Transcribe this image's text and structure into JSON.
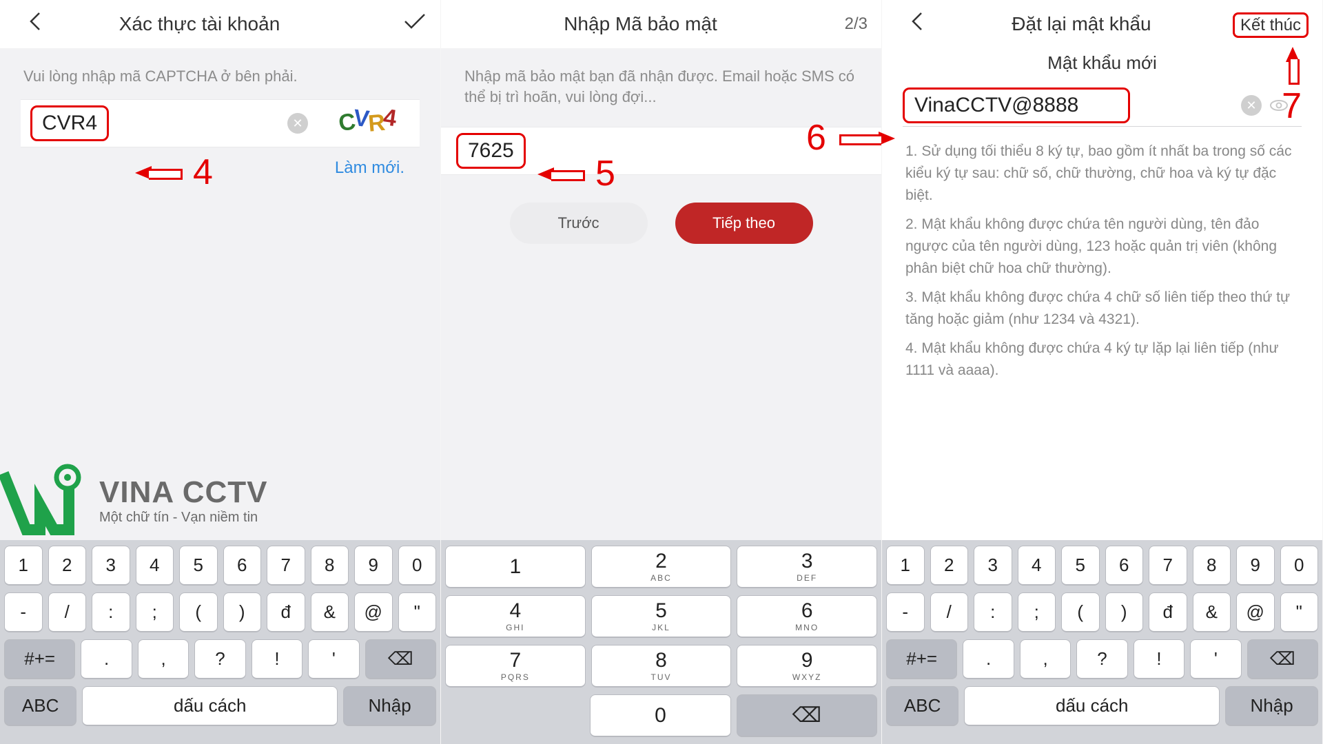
{
  "p1": {
    "title": "Xác thực tài khoản",
    "instruction": "Vui lòng nhập mã CAPTCHA ở bên phải.",
    "captcha_value": "CVR4",
    "captcha_chars": [
      "C",
      "V",
      "R",
      "4"
    ],
    "refresh": "Làm mới.",
    "anno": "4"
  },
  "p2": {
    "title": "Nhập Mã bảo mật",
    "step": "2/3",
    "instruction": "Nhập mã bảo mật bạn đã nhận được. Email hoặc SMS có thể bị trì hoãn, vui lòng đợi...",
    "code_value": "7625",
    "btn_prev": "Trước",
    "btn_next": "Tiếp theo",
    "anno": "5"
  },
  "p3": {
    "title": "Đặt lại mật khẩu",
    "finish": "Kết thúc",
    "subtitle": "Mật khẩu mới",
    "password_value": "VinaCCTV@8888",
    "anno_field": "6",
    "anno_finish": "7",
    "rules": [
      "1. Sử dụng tối thiểu 8 ký tự, bao gồm ít nhất ba trong số các kiểu ký tự sau: chữ số, chữ thường, chữ hoa và ký tự đặc biệt.",
      "2. Mật khẩu không được chứa tên người dùng, tên đảo ngược của tên người dùng, 123 hoặc quản trị viên (không phân biệt chữ hoa chữ thường).",
      "3. Mật khẩu không được chứa 4 chữ số liên tiếp theo thứ tự tăng hoặc giảm (như 1234 và 4321).",
      "4. Mật khẩu không được chứa 4 ký tự lặp lại liên tiếp (như 1111 và aaaa)."
    ]
  },
  "logo": {
    "brand": "VINA CCTV",
    "tagline": "Một chữ tín - Vạn niềm tin"
  },
  "kb_sym": {
    "row1": [
      "1",
      "2",
      "3",
      "4",
      "5",
      "6",
      "7",
      "8",
      "9",
      "0"
    ],
    "row2": [
      "-",
      "/",
      ":",
      ";",
      "(",
      ")",
      "đ",
      "&",
      "@",
      "\""
    ],
    "row3_toggle": "#+=",
    "row3": [
      ".",
      ",",
      "?",
      "!",
      "'"
    ],
    "row3_del": "⌫",
    "row4_abc": "ABC",
    "row4_space": "dấu cách",
    "row4_enter": "Nhập"
  },
  "kb_num": {
    "keys": [
      {
        "d": "1",
        "s": ""
      },
      {
        "d": "2",
        "s": "ABC"
      },
      {
        "d": "3",
        "s": "DEF"
      },
      {
        "d": "4",
        "s": "GHI"
      },
      {
        "d": "5",
        "s": "JKL"
      },
      {
        "d": "6",
        "s": "MNO"
      },
      {
        "d": "7",
        "s": "PQRS"
      },
      {
        "d": "8",
        "s": "TUV"
      },
      {
        "d": "9",
        "s": "WXYZ"
      },
      {
        "d": "",
        "s": ""
      },
      {
        "d": "0",
        "s": ""
      },
      {
        "d": "⌫",
        "s": ""
      }
    ]
  }
}
